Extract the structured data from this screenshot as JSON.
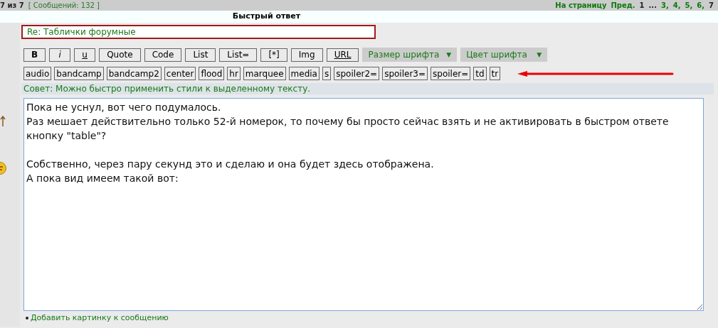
{
  "top_bar": {
    "page_info": "7 из 7",
    "posts_count": "[ Сообщений: 132 ]",
    "pagination_label": "На страницу",
    "pagination": [
      {
        "label": "Пред.",
        "kind": "link"
      },
      {
        "label": "1",
        "kind": "current"
      },
      {
        "label": "...",
        "kind": "text"
      },
      {
        "label": "3,",
        "kind": "link"
      },
      {
        "label": "4,",
        "kind": "link"
      },
      {
        "label": "5,",
        "kind": "link"
      },
      {
        "label": "6,",
        "kind": "link"
      },
      {
        "label": "7",
        "kind": "current"
      }
    ]
  },
  "title": "Быстрый ответ",
  "subject": {
    "value": "Re: Таблички форумные"
  },
  "format_buttons": [
    {
      "label": "B",
      "kind": "bold"
    },
    {
      "label": "i",
      "kind": "italic"
    },
    {
      "label": "u",
      "kind": "underline"
    },
    {
      "label": "Quote",
      "kind": "plain"
    },
    {
      "label": "Code",
      "kind": "plain"
    },
    {
      "label": "List",
      "kind": "plain"
    },
    {
      "label": "List=",
      "kind": "plain"
    },
    {
      "label": "[*]",
      "kind": "plain"
    },
    {
      "label": "Img",
      "kind": "plain"
    },
    {
      "label": "URL",
      "kind": "link"
    }
  ],
  "dropdowns": [
    {
      "label": "Размер шрифта",
      "arrow": "▼"
    },
    {
      "label": "Цвет шрифта",
      "arrow": "▼"
    }
  ],
  "tag_buttons": [
    "audio",
    "bandcamp",
    "bandcamp2",
    "center",
    "flood",
    "hr",
    "marquee",
    "media",
    "s",
    "spoiler2=",
    "spoiler3=",
    "spoiler=",
    "td",
    "tr"
  ],
  "tip": "Совет: Можно быстро применить стили к выделенному тексту.",
  "message": "Пока не уснул, вот чего подумалось.\nРаз мешает действительно только 52-й номерок, то почему бы просто сейчас взять и не активировать в быстром ответе кнопку \"table\"?\n\nСобственно, через пару секунд это и сделаю и она будет здесь отображена.\nА пока вид имеем такой вот:",
  "attach_link": "Добавить картинку к сообщению"
}
